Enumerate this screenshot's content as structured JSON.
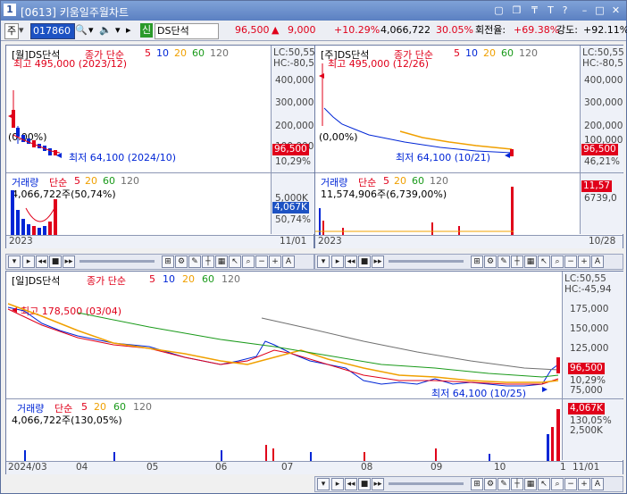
{
  "window": {
    "number": "1",
    "title": "[0613] 키움일주월차트",
    "controls": [
      "restore-icon",
      "copy-icon",
      "pin-icon",
      "text-icon",
      "help-icon",
      "minimize-icon",
      "maximize-icon",
      "close-icon"
    ]
  },
  "toolbar": {
    "market": "주",
    "code": "017860",
    "market_badge": "신",
    "name": "DS단석",
    "price": "96,500",
    "change_arrow": "▲",
    "change": "9,000",
    "change_pct": "+10.29%",
    "volume": "4,066,722",
    "vol_ratio": "30.05%",
    "turnover_label": "회전율:",
    "turnover": "+69.38%",
    "strength_label": "강도:",
    "strength": "+92.11%"
  },
  "monthly": {
    "header": "[월]DS단석",
    "series_label": "종가 단순",
    "mas": [
      "5",
      "10",
      "20",
      "60",
      "120"
    ],
    "lc": "LC:50,55",
    "hc": "HC:-80,5",
    "high_note": "최고 495,000 (2023/12)",
    "low_note": "최저 64,100 (2024/10)",
    "pct_note": "(0.00%)",
    "ticks": [
      "400,000",
      "300,000",
      "200,000",
      "100,000"
    ],
    "price_box": "96,500",
    "price_pct": "10,29%",
    "vol_header": "거래량",
    "vol_series": "단순",
    "vol_mas": [
      "5",
      "20",
      "60",
      "120"
    ],
    "vol_value": "4,066,722주(50,74%)",
    "vol_tick": "5,000K",
    "vol_box": "4,067K",
    "vol_pct": "50,74%",
    "date_left": "2023",
    "date_right": "11/01"
  },
  "weekly": {
    "header": "[주]DS단석",
    "series_label": "종가 단순",
    "mas": [
      "5",
      "10",
      "20",
      "60",
      "120"
    ],
    "lc": "LC:50,55",
    "hc": "HC:-80,5",
    "high_note": "최고 495,000 (12/26)",
    "low_note": "최저 64,100 (10/21)",
    "pct_note": "(0,00%)",
    "ticks": [
      "400,000",
      "300,000",
      "200,000",
      "100,000"
    ],
    "price_box": "96,500",
    "price_pct": "46,21%",
    "vol_header": "거래량",
    "vol_series": "단순",
    "vol_mas": [
      "5",
      "20",
      "60",
      "120"
    ],
    "vol_value": "11,574,906주(6,739,00%)",
    "vol_box": "11,57",
    "vol_pct": "6739,0",
    "date_left": "2023",
    "date_right": "10/28"
  },
  "daily": {
    "header": "[일]DS단석",
    "series_label": "종가 단순",
    "mas": [
      "5",
      "10",
      "20",
      "60",
      "120"
    ],
    "lc": "LC:50,55",
    "hc": "HC:-45,94",
    "high_note": "최고 178,500 (03/04)",
    "low_note": "최저 64,100 (10/25)",
    "ticks": [
      "175,000",
      "150,000",
      "125,000",
      "75,000"
    ],
    "price_box": "96,500",
    "price_pct": "10,29%",
    "vol_header": "거래량",
    "vol_series": "단순",
    "vol_mas": [
      "5",
      "20",
      "60",
      "120"
    ],
    "vol_value": "4,066,722주(130,05%)",
    "vol_tick": "2,500K",
    "vol_box": "4,067K",
    "vol_pct": "130,05%",
    "dates": [
      "2024/03",
      "04",
      "05",
      "06",
      "07",
      "08",
      "09",
      "10",
      "1"
    ],
    "date_right": "11/01"
  },
  "colors": {
    "up": "#e0001a",
    "down": "#0026d6",
    "ma5": "#e0001a",
    "ma10": "#1d52c3",
    "ma20": "#f0a000",
    "ma60": "#1a9a1a",
    "ma120": "#707070"
  }
}
